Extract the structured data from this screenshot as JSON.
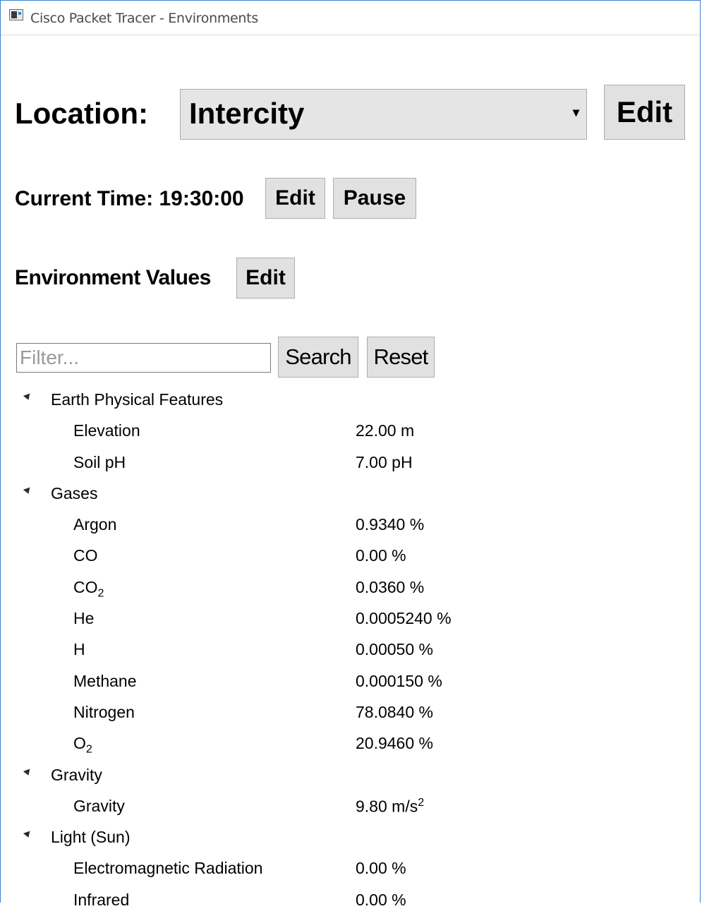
{
  "window": {
    "title": "Cisco Packet Tracer - Environments"
  },
  "location": {
    "label": "Location:",
    "selected": "Intercity",
    "edit_label": "Edit"
  },
  "time": {
    "label": "Current Time: 19:30:00",
    "edit_label": "Edit",
    "pause_label": "Pause"
  },
  "environment": {
    "label": "Environment Values",
    "edit_label": "Edit"
  },
  "filter": {
    "placeholder": "Filter...",
    "search_label": "Search",
    "reset_label": "Reset"
  },
  "tree": {
    "groups": [
      {
        "name": "Earth Physical Features",
        "items": [
          {
            "name": "Elevation",
            "value": "22.00 m"
          },
          {
            "name": "Soil pH",
            "value": "7.00 pH"
          }
        ]
      },
      {
        "name": "Gases",
        "items": [
          {
            "name": "Argon",
            "value": "0.9340 %"
          },
          {
            "name": "CO",
            "value": "0.00 %"
          },
          {
            "name": "CO",
            "sub": "2",
            "value": "0.0360 %"
          },
          {
            "name": "He",
            "value": "0.0005240 %"
          },
          {
            "name": "H",
            "value": "0.00050 %"
          },
          {
            "name": "Methane",
            "value": "0.000150 %"
          },
          {
            "name": "Nitrogen",
            "value": "78.0840 %"
          },
          {
            "name": "O",
            "sub": "2",
            "value": "20.9460 %"
          }
        ]
      },
      {
        "name": "Gravity",
        "items": [
          {
            "name": "Gravity",
            "value": "9.80 m/s",
            "value_sup": "2"
          }
        ]
      },
      {
        "name": "Light (Sun)",
        "items": [
          {
            "name": "Electromagnetic Radiation",
            "value": "0.00 %"
          },
          {
            "name": "Infrared",
            "value": "0.00 %"
          }
        ]
      }
    ]
  }
}
